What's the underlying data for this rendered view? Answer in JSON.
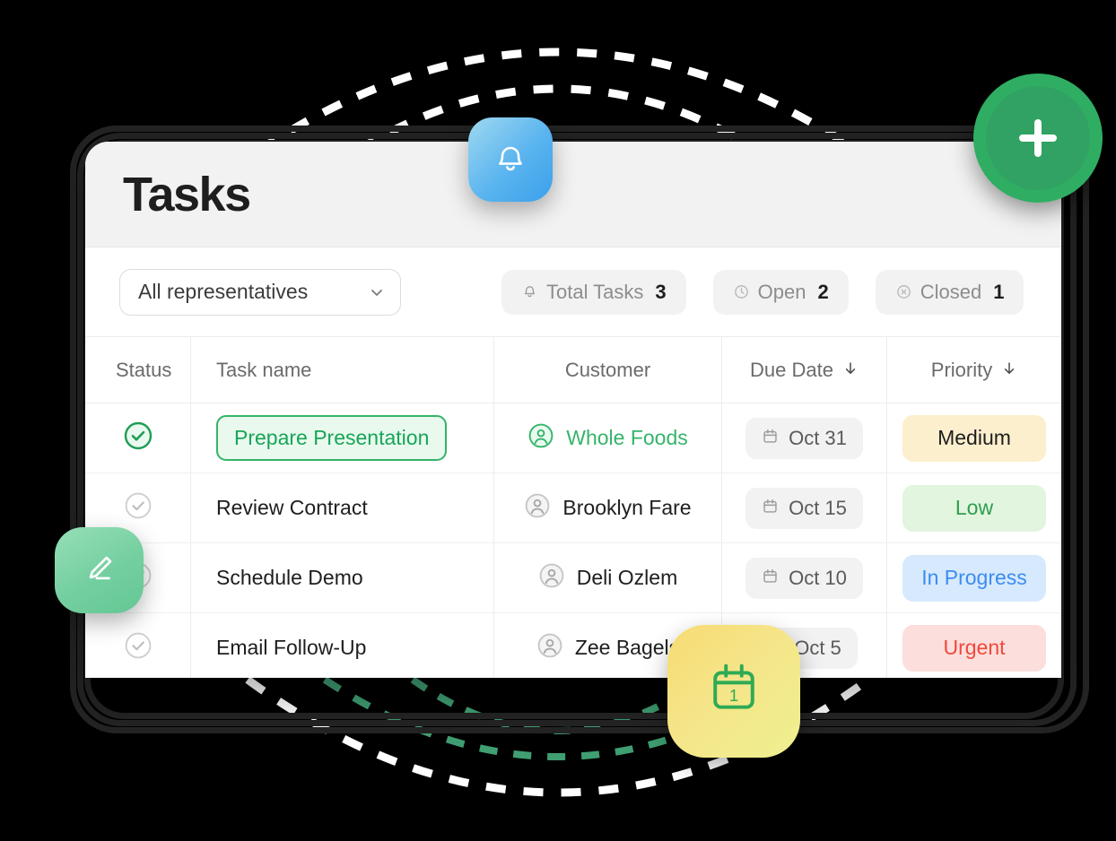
{
  "header": {
    "title": "Tasks"
  },
  "toolbar": {
    "filter_value": "All representatives",
    "filter_icon": "chevron-down-icon",
    "stats": [
      {
        "icon": "bell-icon",
        "label": "Total Tasks",
        "count": "3"
      },
      {
        "icon": "clock-icon",
        "label": "Open",
        "count": "2"
      },
      {
        "icon": "x-circle-icon",
        "label": "Closed",
        "count": "1"
      }
    ]
  },
  "table": {
    "columns": [
      {
        "label": "Status",
        "sortable": false
      },
      {
        "label": "Task name",
        "sortable": false
      },
      {
        "label": "Customer",
        "sortable": false
      },
      {
        "label": "Due Date",
        "sortable": true,
        "sort_icon": "arrow-down-icon"
      },
      {
        "label": "Priority",
        "sortable": true,
        "sort_icon": "arrow-down-icon"
      }
    ],
    "rows": [
      {
        "status_icon": "check-circle-icon",
        "status_state": "complete",
        "task": "Prepare Presentation",
        "task_highlighted": true,
        "customer": "Whole Foods",
        "customer_highlighted": true,
        "due_date": "Oct 31",
        "due_icon": "calendar-icon",
        "priority": "Medium",
        "priority_style": "medium"
      },
      {
        "status_icon": "check-circle-icon",
        "status_state": "incomplete",
        "task": "Review Contract",
        "task_highlighted": false,
        "customer": "Brooklyn Fare",
        "customer_highlighted": false,
        "due_date": "Oct 15",
        "due_icon": "calendar-icon",
        "priority": "Low",
        "priority_style": "low"
      },
      {
        "status_icon": "check-circle-icon",
        "status_state": "incomplete",
        "task": "Schedule Demo",
        "task_highlighted": false,
        "customer": "Deli Ozlem",
        "customer_highlighted": false,
        "due_date": "Oct 10",
        "due_icon": "calendar-icon",
        "priority": "In Progress",
        "priority_style": "progress"
      },
      {
        "status_icon": "check-circle-icon",
        "status_state": "incomplete",
        "task": "Email Follow-Up",
        "task_highlighted": false,
        "customer": "Zee Bagels",
        "customer_highlighted": false,
        "due_date": "Oct 5",
        "due_icon": "calendar-icon",
        "priority": "Urgent",
        "priority_style": "urgent"
      }
    ]
  },
  "floating": {
    "add_button": {
      "icon": "plus-icon"
    },
    "bell_badge": {
      "icon": "bell-icon"
    },
    "edit_badge": {
      "icon": "pencil-edit-icon"
    },
    "calendar_badge": {
      "icon": "calendar-icon",
      "day": "1"
    }
  },
  "colors": {
    "accent_green": "#35b46a",
    "fab_green": "#2fae63",
    "badge_medium_bg": "#fcefcd",
    "badge_low_bg": "#e2f5de",
    "badge_progress_bg": "#d7e9fd",
    "badge_urgent_bg": "#fcdedc",
    "background": "#000000"
  }
}
